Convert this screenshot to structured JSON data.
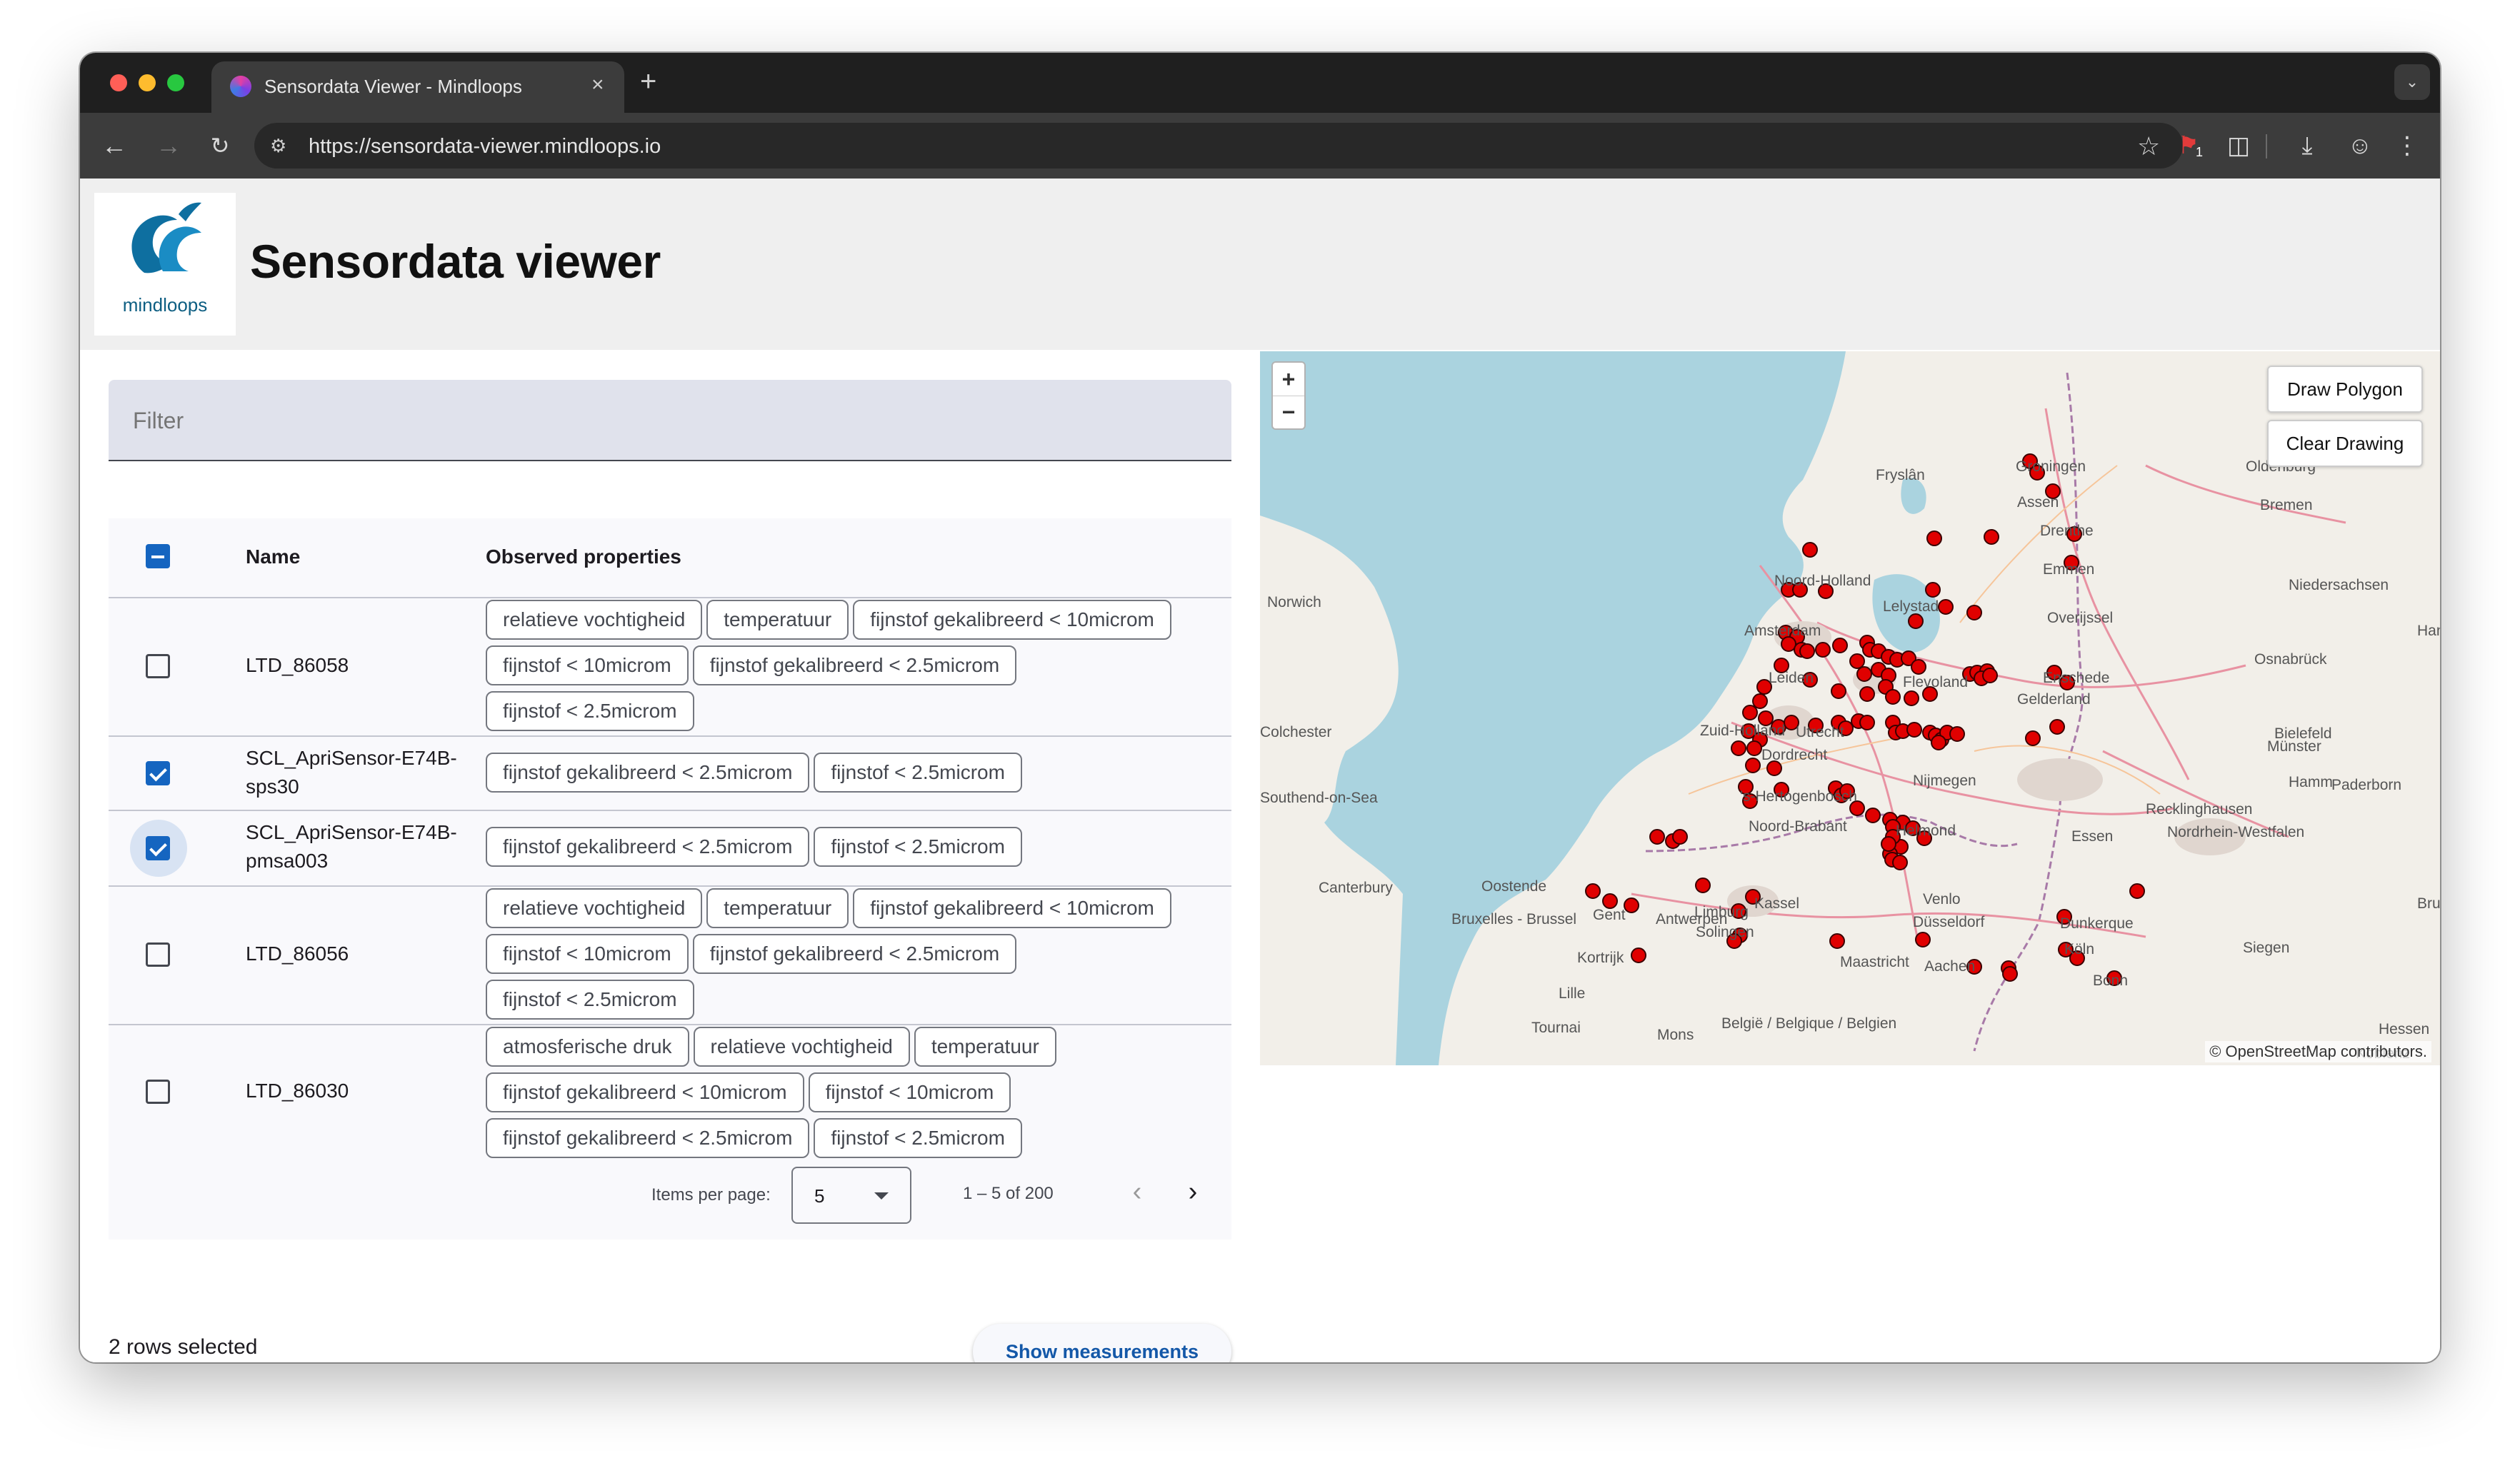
{
  "browser": {
    "tab_title": "Sensordata Viewer - Mindloops",
    "tab_close": "×",
    "new_tab": "+",
    "url": "https://sensordata-viewer.mindloops.io",
    "extension_badge": "1"
  },
  "header": {
    "logo_text": "mindloops",
    "title": "Sensordata viewer"
  },
  "filter": {
    "placeholder": "Filter"
  },
  "table": {
    "columns": {
      "name": "Name",
      "properties": "Observed properties"
    },
    "rows": [
      {
        "name": "LTD_86058",
        "checked": false,
        "properties": [
          "relatieve vochtigheid",
          "temperatuur",
          "fijnstof gekalibreerd < 10microm",
          "fijnstof < 10microm",
          "fijnstof gekalibreerd < 2.5microm",
          "fijnstof < 2.5microm"
        ]
      },
      {
        "name": "SCL_ApriSensor-E74B-sps30",
        "checked": true,
        "properties": [
          "fijnstof gekalibreerd < 2.5microm",
          "fijnstof < 2.5microm"
        ]
      },
      {
        "name": "SCL_ApriSensor-E74B-pmsa003",
        "checked": true,
        "properties": [
          "fijnstof gekalibreerd < 2.5microm",
          "fijnstof < 2.5microm"
        ]
      },
      {
        "name": "LTD_86056",
        "checked": false,
        "properties": [
          "relatieve vochtigheid",
          "temperatuur",
          "fijnstof gekalibreerd < 10microm",
          "fijnstof < 10microm",
          "fijnstof gekalibreerd < 2.5microm",
          "fijnstof < 2.5microm"
        ]
      },
      {
        "name": "LTD_86030",
        "checked": false,
        "properties": [
          "atmosferische druk",
          "relatieve vochtigheid",
          "temperatuur",
          "fijnstof gekalibreerd < 10microm",
          "fijnstof < 10microm",
          "fijnstof gekalibreerd < 2.5microm",
          "fijnstof < 2.5microm"
        ]
      }
    ]
  },
  "paginator": {
    "items_label": "Items per page:",
    "page_size": "5",
    "range": "1 – 5 of 200"
  },
  "footer": {
    "selected_text": "2 rows selected",
    "show_button": "Show measurements"
  },
  "map": {
    "zoom_in": "+",
    "zoom_out": "−",
    "draw_polygon": "Draw Polygon",
    "clear_drawing": "Clear Drawing",
    "attribution": "© OpenStreetMap contributors.",
    "marker_color": "#e00000",
    "labels": [
      "Fryslân",
      "Groningen",
      "Oldenburg",
      "Bremen",
      "Assen",
      "Drenthe",
      "Emmen",
      "Niedersachsen",
      "Norwich",
      "Noord-Holland",
      "Lelystad",
      "Overijssel",
      "Amsterdam",
      "Osnabrück",
      "Hann",
      "Leiden",
      "Flevoland",
      "Enschede",
      "Gelderland",
      "Colchester",
      "Zuid-Holland",
      "Utrecht",
      "Dordrecht",
      "Bielefeld",
      "Münster",
      "Nijmegen",
      "Hamm",
      "Paderborn",
      "Southend-on-Sea",
      "'s-Hertogenbosch",
      "Recklinghausen",
      "Noord-Brabant",
      "Helmond",
      "Essen",
      "Nordrhein-Westfalen",
      "Canterbury",
      "Oostende",
      "Venlo",
      "Kassel",
      "Brugge",
      "Gent",
      "Antwerpen",
      "Limburg",
      "Düsseldorf",
      "Dunkerque",
      "Bruxelles - Brussel",
      "Solingen",
      "Köln",
      "Siegen",
      "Kortrijk",
      "Maastricht",
      "Aachen",
      "Bonn",
      "Lille",
      "België / Belgique / Belgien",
      "Tournai",
      "Mons",
      "Hessen",
      "Koblenz"
    ]
  }
}
